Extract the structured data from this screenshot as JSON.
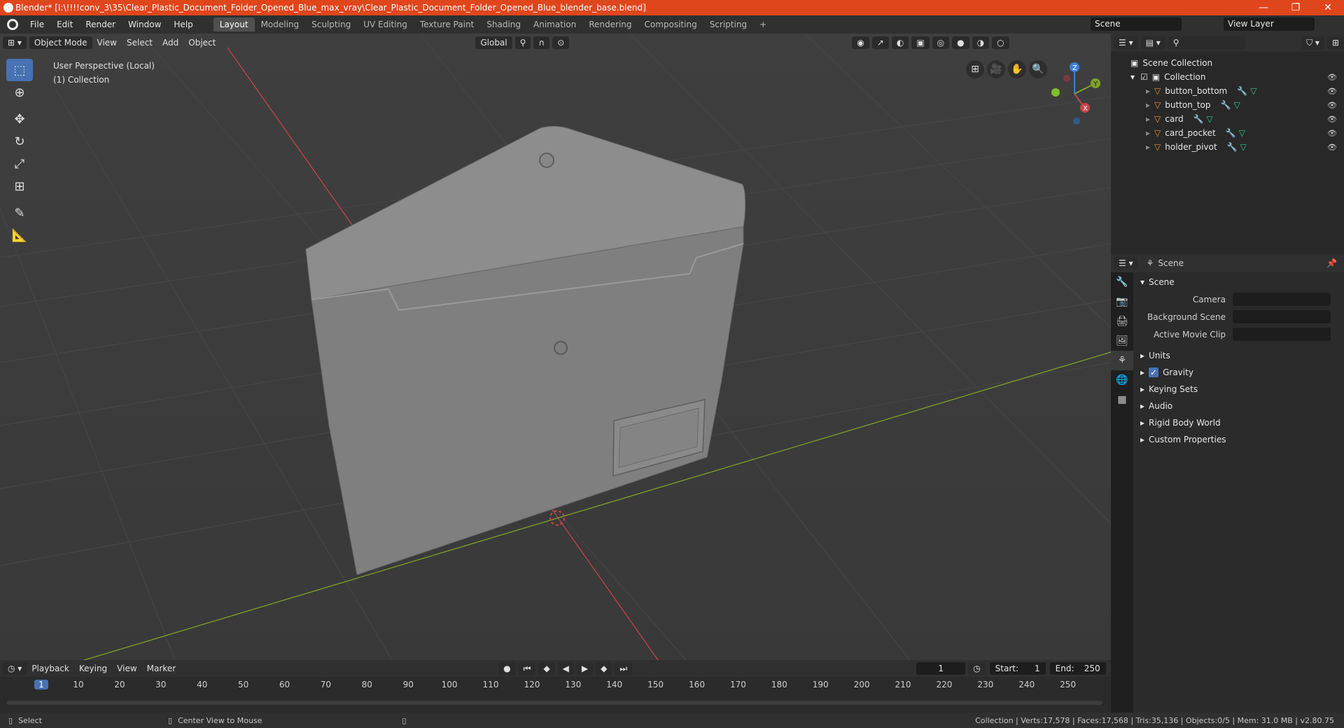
{
  "window": {
    "title": "Blender* [I:\\!!!!conv_3\\35\\Clear_Plastic_Document_Folder_Opened_Blue_max_vray\\Clear_Plastic_Document_Folder_Opened_Blue_blender_base.blend]",
    "minimize": "—",
    "maximize": "❐",
    "close": "✕"
  },
  "menubar": {
    "items": [
      "File",
      "Edit",
      "Render",
      "Window",
      "Help"
    ],
    "workspaces": [
      "Layout",
      "Modeling",
      "Sculpting",
      "UV Editing",
      "Texture Paint",
      "Shading",
      "Animation",
      "Rendering",
      "Compositing",
      "Scripting"
    ],
    "add_workspace": "+",
    "scene": "Scene",
    "view_layer": "View Layer"
  },
  "viewport": {
    "mode": "Object Mode",
    "menus": [
      "View",
      "Select",
      "Add",
      "Object"
    ],
    "transform_orientation": "Global",
    "info_line1": "User Perspective (Local)",
    "info_line2": "(1) Collection"
  },
  "outliner": {
    "root": "Scene Collection",
    "collection": "Collection",
    "objects": [
      "button_bottom",
      "button_top",
      "card",
      "card_pocket",
      "holder_pivot"
    ]
  },
  "properties": {
    "context": "Scene",
    "panel_title": "Scene",
    "camera_label": "Camera",
    "bg_scene_label": "Background Scene",
    "movie_clip_label": "Active Movie Clip",
    "sections": [
      "Units",
      "Gravity",
      "Keying Sets",
      "Audio",
      "Rigid Body World",
      "Custom Properties"
    ],
    "gravity_checked": true
  },
  "timeline": {
    "menus": [
      "Playback",
      "Keying",
      "View",
      "Marker"
    ],
    "current_frame": "1",
    "start_label": "Start:",
    "start": "1",
    "end_label": "End:",
    "end": "250",
    "ticks": [
      "1",
      "10",
      "20",
      "30",
      "40",
      "50",
      "60",
      "70",
      "80",
      "90",
      "100",
      "110",
      "120",
      "130",
      "140",
      "150",
      "160",
      "170",
      "180",
      "190",
      "200",
      "210",
      "220",
      "230",
      "240",
      "250"
    ]
  },
  "statusbar": {
    "select": "Select",
    "center_view": "Center View to Mouse",
    "stats": "Collection | Verts:17,578 | Faces:17,568 | Tris:35,136 | Objects:0/5 | Mem: 31.0 MB | v2.80.75"
  },
  "colors": {
    "title_bar": "#e0461c",
    "accent": "#4772b3",
    "x_axis": "#c7424c",
    "y_axis": "#7ea12b",
    "z_axis": "#3a7fd6",
    "object_orange": "#e8913a"
  }
}
